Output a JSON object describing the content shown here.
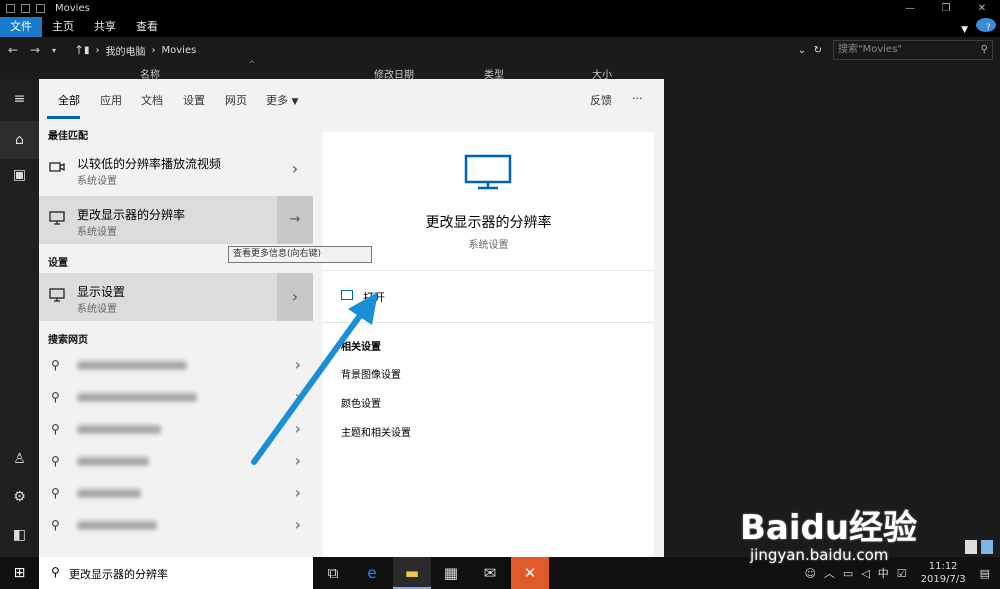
{
  "window": {
    "title": "Movies"
  },
  "ribbon": {
    "file": "文件",
    "home": "主页",
    "share": "共享",
    "view": "查看"
  },
  "address": {
    "path": [
      "我的电脑",
      "Movies"
    ],
    "search_placeholder": "搜索\"Movies\""
  },
  "columns": [
    "名称",
    "修改日期",
    "类型",
    "大小"
  ],
  "tabs": {
    "all": "全部",
    "apps": "应用",
    "docs": "文档",
    "settings": "设置",
    "web": "网页",
    "more": "更多",
    "feedback": "反馈",
    "dots": "···"
  },
  "best_match": {
    "heading": "最佳匹配",
    "items": [
      {
        "title": "以较低的分辨率播放流视频",
        "subtitle": "系统设置"
      },
      {
        "title": "更改显示器的分辨率",
        "subtitle": "系统设置"
      }
    ]
  },
  "tooltip": "查看更多信息(向右键)",
  "settings_section": {
    "heading": "设置",
    "items": [
      {
        "title": "显示设置",
        "subtitle": "系统设置"
      }
    ]
  },
  "web_section": {
    "heading": "搜索网页",
    "suffixes": [
      "",
      "设置工具win10",
      "设置工具",
      "怎么调",
      "像素",
      "300dpi"
    ]
  },
  "detail": {
    "title": "更改显示器的分辨率",
    "subtitle": "系统设置",
    "open": "打开",
    "related_heading": "相关设置",
    "related": [
      "背景图像设置",
      "颜色设置",
      "主题和相关设置"
    ]
  },
  "search_query": "更改显示器的分辨率",
  "tray": {
    "ime": "中",
    "time": "11:12",
    "date": "2019/7/3"
  },
  "watermark": {
    "brand": "Baidu经验",
    "url": "jingyan.baidu.com"
  },
  "colors": {
    "accent": "#0063b1",
    "arrow": "#1a8fd6"
  }
}
